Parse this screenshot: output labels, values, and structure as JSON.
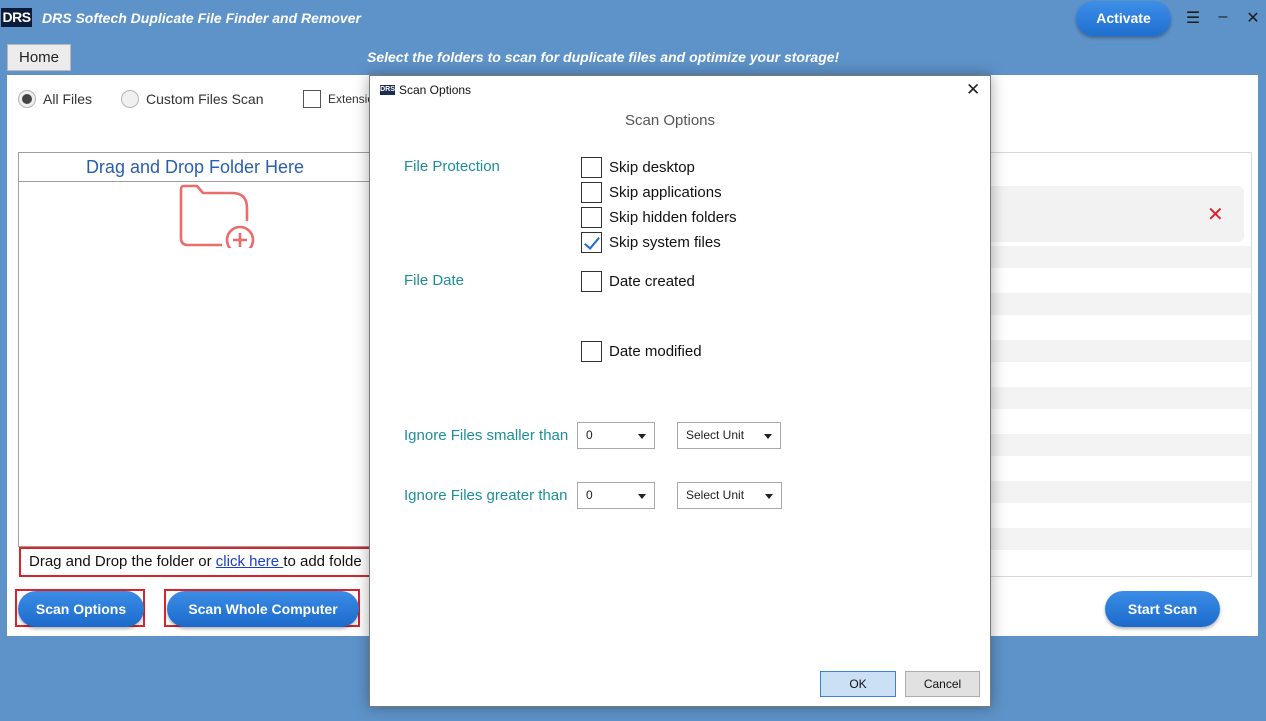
{
  "window": {
    "logo": "DRS",
    "title": "DRS Softech Duplicate File Finder and Remover",
    "activate_label": "Activate",
    "menu_icon": "hamburger-menu-icon",
    "minimize_icon": "minimize-icon",
    "close_icon": "close-icon"
  },
  "nav": {
    "home_label": "Home",
    "subtitle": "Select the folders to scan for duplicate files and optimize your storage!"
  },
  "scan_mode": {
    "all_files_label": "All Files",
    "custom_label": "Custom Files Scan",
    "extension_label": "Extensio",
    "selected": "All Files"
  },
  "drop_area": {
    "header": "Drag and Drop Folder Here",
    "icon": "folder-add-icon",
    "footer_prefix": "Drag and Drop the folder or",
    "footer_link": " click here ",
    "footer_suffix": "to add folde"
  },
  "buttons": {
    "scan_options": "Scan Options",
    "scan_whole_computer": "Scan Whole Computer",
    "start_scan": "Start Scan"
  },
  "selected_folder": {
    "remove_icon": "remove-x-icon"
  },
  "dialog": {
    "window_title": "Scan Options",
    "icon_text": "DRS",
    "heading": "Scan Options",
    "file_protection_label": "File Protection",
    "file_protection_options": [
      {
        "label": "Skip desktop",
        "checked": false
      },
      {
        "label": "Skip applications",
        "checked": false
      },
      {
        "label": "Skip hidden folders",
        "checked": false
      },
      {
        "label": "Skip system files",
        "checked": true
      }
    ],
    "file_date_label": "File Date",
    "date_created_label": "Date created",
    "date_created_checked": false,
    "date_modified_label": "Date modified",
    "date_modified_checked": false,
    "ignore_smaller_label": "Ignore Files smaller than",
    "ignore_smaller_value": "0",
    "ignore_smaller_unit": "Select Unit",
    "ignore_greater_label": "Ignore Files greater than",
    "ignore_greater_value": "0",
    "ignore_greater_unit": "Select Unit",
    "ok_label": "OK",
    "cancel_label": "Cancel"
  }
}
